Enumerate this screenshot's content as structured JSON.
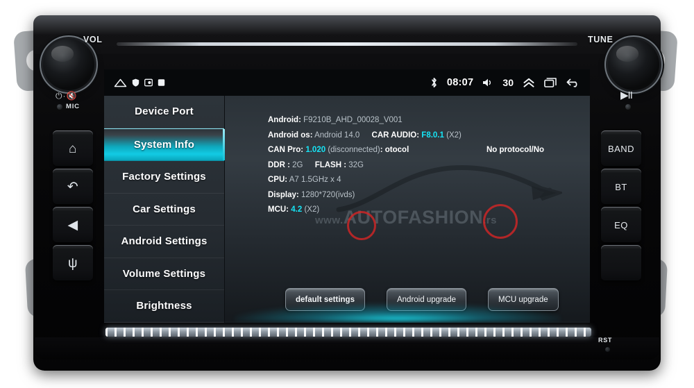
{
  "device": {
    "knob_left_label": "VOL",
    "knob_right_label": "TUNE",
    "power_mute_glyph": "⏻·🔇",
    "mic_label": "MIC",
    "play_pause_glyph": "▶II",
    "reset_label": "RST",
    "left_buttons": [
      {
        "name": "home",
        "glyph": "⌂"
      },
      {
        "name": "back",
        "glyph": "↶"
      },
      {
        "name": "navigation",
        "glyph": "◀"
      },
      {
        "name": "usb",
        "glyph": "ψ"
      }
    ],
    "right_buttons": [
      {
        "name": "band",
        "label": "BAND"
      },
      {
        "name": "bt",
        "label": "BT"
      },
      {
        "name": "eq",
        "label": "EQ"
      },
      {
        "name": "blank",
        "label": ""
      }
    ]
  },
  "statusbar": {
    "home_icon": "home-icon",
    "left_icons": [
      "shield-icon",
      "screenshot-icon",
      "sd-card-icon"
    ],
    "bluetooth_icon": "bluetooth-icon",
    "clock": "08:07",
    "speaker_icon": "speaker-icon",
    "volume": "30",
    "expand_icon": "chevron-up-icon",
    "recents_icon": "recents-icon",
    "back_icon": "back-arrow-icon"
  },
  "sidebar": {
    "items": [
      {
        "label": "Device Port",
        "active": false
      },
      {
        "label": "System Info",
        "active": true
      },
      {
        "label": "Factory Settings",
        "active": false
      },
      {
        "label": "Car Settings",
        "active": false
      },
      {
        "label": "Android Settings",
        "active": false
      },
      {
        "label": "Volume Settings",
        "active": false
      },
      {
        "label": "Brightness",
        "active": false
      }
    ]
  },
  "system_info": {
    "android_key": "Android:",
    "android_value": "F9210B_AHD_00028_V001",
    "android_os_key": "Android os:",
    "android_os_value": "Android 14.0",
    "car_audio_key": "CAR AUDIO:",
    "car_audio_value": "F8.0.1",
    "car_audio_suffix": "(X2)",
    "can_pro_key": "CAN Pro:",
    "can_pro_value": "1.020",
    "can_pro_state": "(disconnected)",
    "can_pro_protocol_label": ": otocol",
    "can_pro_protocol_value": "No protocol/No",
    "ddr_key": "DDR :",
    "ddr_value": "2G",
    "flash_key": "FLASH :",
    "flash_value": "32G",
    "cpu_key": "CPU:",
    "cpu_value": "A7 1.5GHz x 4",
    "display_key": "Display:",
    "display_value": "1280*720(ivds)",
    "mcu_key": "MCU:",
    "mcu_value": "4.2",
    "mcu_suffix": "(X2)"
  },
  "actions": {
    "default_settings": "default settings",
    "android_upgrade": "Android upgrade",
    "mcu_upgrade": "MCU upgrade"
  },
  "watermark": {
    "prefix": "www.",
    "brand": "AUTOFASHION",
    "suffix": ".rs"
  },
  "colors": {
    "accent_cyan": "#12cbe4",
    "value_cyan": "#16e4f5",
    "watermark_red": "#d62626",
    "screen_bg": "#2b3238"
  }
}
